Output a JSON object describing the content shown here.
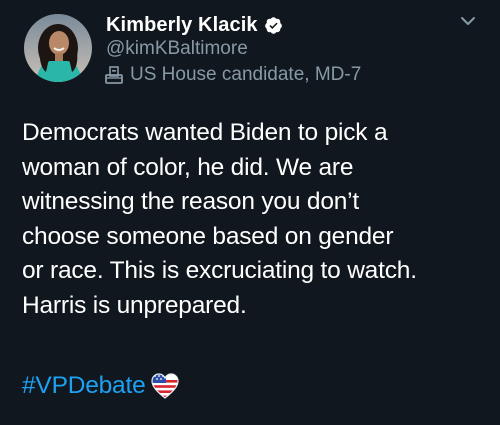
{
  "author": {
    "display_name": "Kimberly Klacik",
    "handle": "@kimKBaltimore",
    "label": "US House candidate, MD-7",
    "verified_icon": "verified-badge-icon",
    "label_icon": "ballot-box-icon"
  },
  "tweet": {
    "lines": [
      "Democrats wanted Biden to pick a",
      "woman of color, he did. We are",
      "witnessing the reason you don’t",
      "choose someone based on gender",
      "or race. This is excruciating to watch.",
      "Harris is unprepared."
    ],
    "hashtag": "#VPDebate",
    "hashtag_emoji_icon": "american-flag-heart-icon"
  },
  "colors": {
    "background": "#10171e",
    "primary_text": "#ffffff",
    "secondary_text": "#8899a6",
    "link": "#1da1f2"
  }
}
